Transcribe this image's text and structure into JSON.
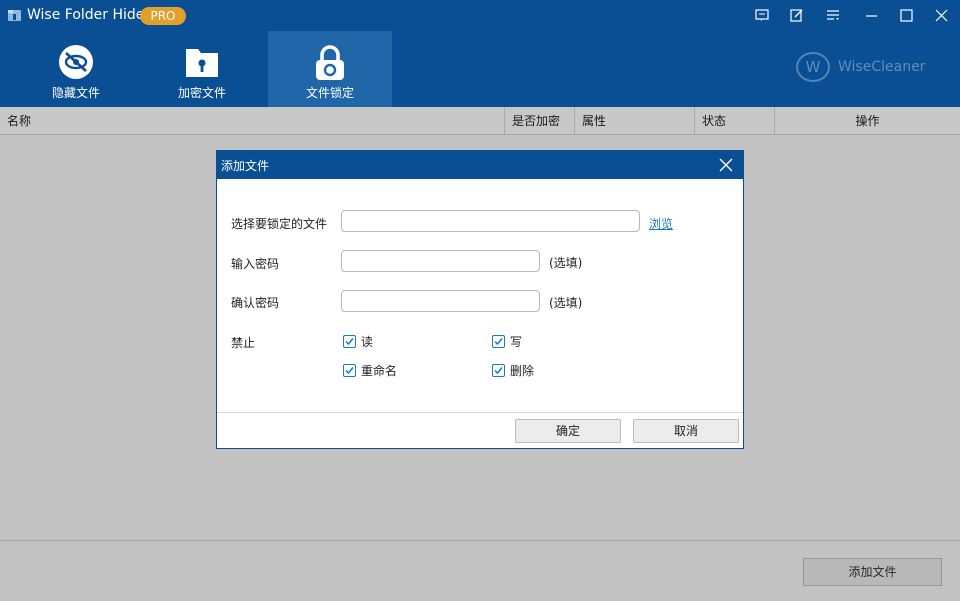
{
  "app": {
    "title": "Wise Folder Hider",
    "badge": "PRO",
    "brand": "WiseCleaner",
    "brand_mark": "W"
  },
  "window_controls": [
    "feedback-icon",
    "edit-icon",
    "menu-icon",
    "minimize-icon",
    "maximize-icon",
    "close-icon"
  ],
  "tabs": [
    {
      "label": "隐藏文件",
      "icon": "eye-slash-icon",
      "active": false
    },
    {
      "label": "加密文件",
      "icon": "folder-lock-icon",
      "active": false
    },
    {
      "label": "文件锁定",
      "icon": "padlock-icon",
      "active": true
    }
  ],
  "table": {
    "columns": [
      "名称",
      "是否加密",
      "属性",
      "状态",
      "操作"
    ]
  },
  "footer": {
    "add_file_label": "添加文件"
  },
  "dialog": {
    "title": "添加文件",
    "file_label": "选择要锁定的文件",
    "file_value": "",
    "browse_label": "浏览",
    "password_label": "输入密码",
    "password_value": "",
    "password_hint": "(选填)",
    "confirm_label": "确认密码",
    "confirm_value": "",
    "confirm_hint": "(选填)",
    "forbid_label": "禁止",
    "options": [
      {
        "label": "读",
        "checked": true
      },
      {
        "label": "写",
        "checked": true
      },
      {
        "label": "重命名",
        "checked": true
      },
      {
        "label": "删除",
        "checked": true
      }
    ],
    "ok_label": "确定",
    "cancel_label": "取消"
  },
  "colors": {
    "header": "#0a4f94",
    "active_tab": "#2066a8",
    "badge": "#e0a02a",
    "link": "#1a78c2"
  }
}
